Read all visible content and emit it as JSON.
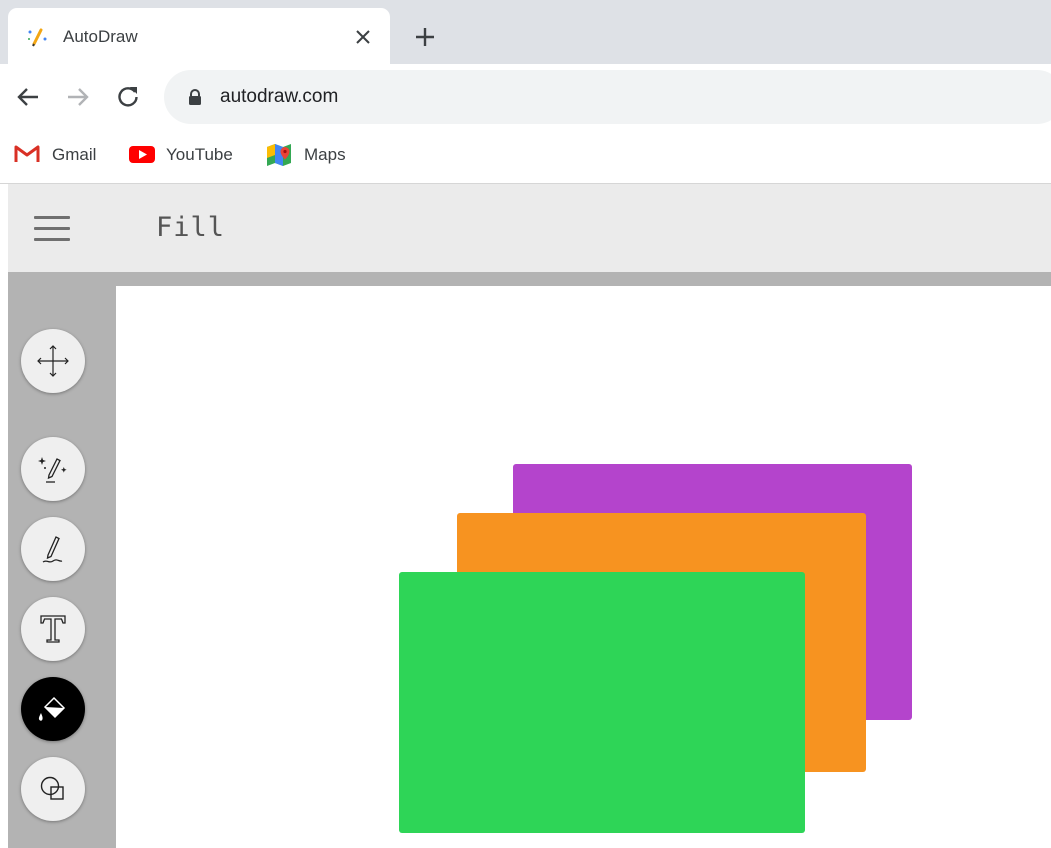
{
  "browser": {
    "tab": {
      "title": "AutoDraw",
      "favicon": "autodraw-pencil-icon",
      "close_icon": "close-icon"
    },
    "new_tab_icon": "plus-icon",
    "nav": {
      "back_icon": "arrow-left-icon",
      "forward_icon": "arrow-right-icon",
      "reload_icon": "reload-icon"
    },
    "omnibox": {
      "lock_icon": "lock-icon",
      "url": "autodraw.com"
    },
    "bookmarks": [
      {
        "label": "Gmail",
        "icon": "gmail-icon"
      },
      {
        "label": "YouTube",
        "icon": "youtube-icon"
      },
      {
        "label": "Maps",
        "icon": "maps-icon"
      }
    ]
  },
  "app": {
    "menu_icon": "hamburger-menu-icon",
    "mode_title": "Fill",
    "tools": [
      {
        "name": "select",
        "icon": "move-arrows-icon",
        "active": false
      },
      {
        "name": "autodraw",
        "icon": "sparkle-pencil-icon",
        "active": false
      },
      {
        "name": "draw",
        "icon": "pencil-icon",
        "active": false
      },
      {
        "name": "type",
        "icon": "text-t-icon",
        "active": false
      },
      {
        "name": "fill",
        "icon": "paint-bucket-icon",
        "active": true
      },
      {
        "name": "shape",
        "icon": "shapes-icon",
        "active": false
      }
    ],
    "canvas_shapes": [
      {
        "kind": "rectangle",
        "fill": "#b444cc"
      },
      {
        "kind": "rectangle",
        "fill": "#f79320"
      },
      {
        "kind": "rectangle",
        "fill": "#2ed557"
      }
    ]
  },
  "colors": {
    "tabstrip": "#dee1e6",
    "app_header": "#ebebeb",
    "workspace": "#b3b3b3",
    "active_tool": "#000000"
  }
}
